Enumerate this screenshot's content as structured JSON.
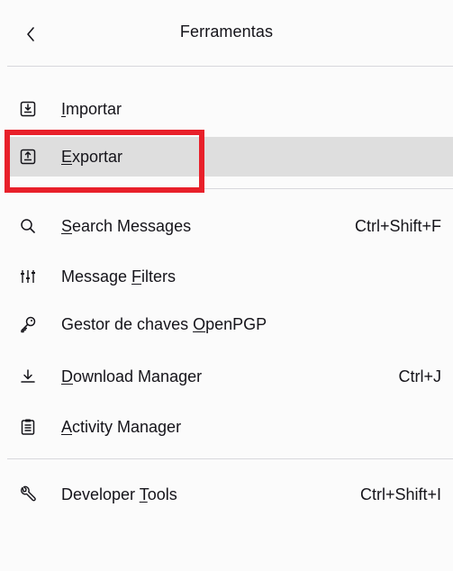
{
  "header": {
    "title": "Ferramentas",
    "back_icon": "chevron-left-icon"
  },
  "menu": {
    "import": {
      "pre": "",
      "key": "I",
      "post": "mportar",
      "shortcut": "",
      "icon": "import-icon"
    },
    "export": {
      "pre": "",
      "key": "E",
      "post": "xportar",
      "shortcut": "",
      "icon": "export-icon",
      "hovered": true
    },
    "search": {
      "pre": "",
      "key": "S",
      "post": "earch Messages",
      "shortcut": "Ctrl+Shift+F",
      "icon": "search-icon"
    },
    "filters": {
      "pre": "Message ",
      "key": "F",
      "post": "ilters",
      "shortcut": "",
      "icon": "filters-icon"
    },
    "openpgp": {
      "pre": "Gestor de chaves ",
      "key": "O",
      "post": "penPGP",
      "shortcut": "",
      "icon": "key-icon"
    },
    "downloads": {
      "pre": "",
      "key": "D",
      "post": "ownload Manager",
      "shortcut": "Ctrl+J",
      "icon": "download-icon"
    },
    "activity": {
      "pre": "",
      "key": "A",
      "post": "ctivity Manager",
      "shortcut": "",
      "icon": "activity-icon"
    },
    "devtools": {
      "pre": "Developer ",
      "key": "T",
      "post": "ools",
      "shortcut": "Ctrl+Shift+I",
      "icon": "wrench-icon"
    }
  },
  "colors": {
    "highlight_border": "#e8202a",
    "hover_background": "#dedede",
    "separator": "#d8d8dc"
  }
}
